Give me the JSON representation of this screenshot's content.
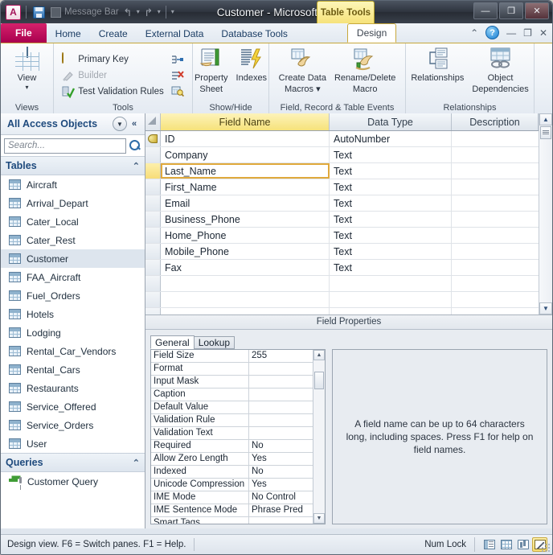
{
  "window": {
    "title": "Customer  -  Microsoft A...",
    "context_tab_banner": "Table Tools",
    "minimize": "—",
    "restore": "❐",
    "close": "✕"
  },
  "qat": {
    "logo": "A",
    "save_icon": "save-icon",
    "message_bar_label": "Message Bar",
    "undo": "↰",
    "redo": "↱",
    "customize": "▾"
  },
  "tabs": [
    {
      "label": "File",
      "kind": "file"
    },
    {
      "label": "Home",
      "kind": "normal"
    },
    {
      "label": "Create",
      "kind": "normal"
    },
    {
      "label": "External Data",
      "kind": "normal"
    },
    {
      "label": "Database Tools",
      "kind": "normal"
    },
    {
      "label": "Design",
      "kind": "contextual-active"
    }
  ],
  "tab_right": {
    "collapse_ribbon": "⌃",
    "help": "?",
    "minimize": "—",
    "restore": "❐",
    "close": "✕"
  },
  "ribbon": {
    "groups": [
      {
        "name": "Views",
        "label": "Views",
        "big_buttons": [
          {
            "label": "View",
            "sub": "▾",
            "icon": "table-view-icon"
          }
        ]
      },
      {
        "name": "Tools",
        "label": "Tools",
        "small_buttons": [
          {
            "label": "Primary Key",
            "icon": "key-icon",
            "disabled": false
          },
          {
            "label": "Builder",
            "icon": "builder-icon",
            "disabled": true
          },
          {
            "label": "Test Validation Rules",
            "icon": "validation-icon",
            "disabled": false
          }
        ],
        "icon_column": [
          {
            "icon": "insert-rows-icon"
          },
          {
            "icon": "delete-rows-icon"
          },
          {
            "icon": "modify-lookups-icon"
          }
        ]
      },
      {
        "name": "Show/Hide",
        "label": "Show/Hide",
        "big_buttons": [
          {
            "label": "Property",
            "label2": "Sheet",
            "icon": "property-sheet-icon"
          },
          {
            "label": "Indexes",
            "label2": "",
            "icon": "indexes-icon"
          }
        ]
      },
      {
        "name": "Field, Record & Table Events",
        "label": "Field, Record & Table Events",
        "big_buttons": [
          {
            "label": "Create Data",
            "label2": "Macros ▾",
            "icon": "create-data-macros-icon"
          },
          {
            "label": "Rename/Delete",
            "label2": "Macro",
            "icon": "rename-delete-macro-icon"
          }
        ]
      },
      {
        "name": "Relationships",
        "label": "Relationships",
        "big_buttons": [
          {
            "label": "Relationships",
            "label2": "",
            "icon": "relationships-icon"
          },
          {
            "label": "Object",
            "label2": "Dependencies",
            "icon": "object-dependencies-icon"
          }
        ]
      }
    ]
  },
  "navpane": {
    "title": "All Access Objects",
    "dropdown_icon": "chevron-down-icon",
    "collapse_icon": "double-chevron-left-icon",
    "search_placeholder": "Search...",
    "search_value": "",
    "search_icon": "search-icon",
    "groups": [
      {
        "header": "Tables",
        "collapse": "⌃",
        "items": [
          {
            "label": "Aircraft",
            "selected": false
          },
          {
            "label": "Arrival_Depart",
            "selected": false
          },
          {
            "label": "Cater_Local",
            "selected": false
          },
          {
            "label": "Cater_Rest",
            "selected": false
          },
          {
            "label": "Customer",
            "selected": true
          },
          {
            "label": "FAA_Aircraft",
            "selected": false
          },
          {
            "label": "Fuel_Orders",
            "selected": false
          },
          {
            "label": "Hotels",
            "selected": false
          },
          {
            "label": "Lodging",
            "selected": false
          },
          {
            "label": "Rental_Car_Vendors",
            "selected": false
          },
          {
            "label": "Rental_Cars",
            "selected": false
          },
          {
            "label": "Restaurants",
            "selected": false
          },
          {
            "label": "Service_Offered",
            "selected": false
          },
          {
            "label": "Service_Orders",
            "selected": false
          },
          {
            "label": "User",
            "selected": false
          }
        ]
      },
      {
        "header": "Queries",
        "collapse": "⌃",
        "items": [
          {
            "label": "Customer Query",
            "selected": false,
            "icon": "query-icon"
          }
        ]
      }
    ]
  },
  "design_grid": {
    "columns": [
      "Field Name",
      "Data Type",
      "Description"
    ],
    "rows": [
      {
        "field": "ID",
        "type": "AutoNumber",
        "description": "",
        "primary_key": true,
        "current": false
      },
      {
        "field": "Company",
        "type": "Text",
        "description": "",
        "primary_key": false,
        "current": false
      },
      {
        "field": "Last_Name",
        "type": "Text",
        "description": "",
        "primary_key": false,
        "current": true
      },
      {
        "field": "First_Name",
        "type": "Text",
        "description": "",
        "primary_key": false,
        "current": false
      },
      {
        "field": "Email",
        "type": "Text",
        "description": "",
        "primary_key": false,
        "current": false
      },
      {
        "field": "Business_Phone",
        "type": "Text",
        "description": "",
        "primary_key": false,
        "current": false
      },
      {
        "field": "Home_Phone",
        "type": "Text",
        "description": "",
        "primary_key": false,
        "current": false
      },
      {
        "field": "Mobile_Phone",
        "type": "Text",
        "description": "",
        "primary_key": false,
        "current": false
      },
      {
        "field": "Fax",
        "type": "Text",
        "description": "",
        "primary_key": false,
        "current": false
      }
    ],
    "scroll_up": "▲",
    "scroll_down": "▼"
  },
  "field_properties": {
    "title": "Field Properties",
    "tabs": [
      {
        "label": "General",
        "active": true
      },
      {
        "label": "Lookup",
        "active": false
      }
    ],
    "rows": [
      {
        "name": "Field Size",
        "value": "255"
      },
      {
        "name": "Format",
        "value": ""
      },
      {
        "name": "Input Mask",
        "value": ""
      },
      {
        "name": "Caption",
        "value": ""
      },
      {
        "name": "Default Value",
        "value": ""
      },
      {
        "name": "Validation Rule",
        "value": ""
      },
      {
        "name": "Validation Text",
        "value": ""
      },
      {
        "name": "Required",
        "value": "No"
      },
      {
        "name": "Allow Zero Length",
        "value": "Yes"
      },
      {
        "name": "Indexed",
        "value": "No"
      },
      {
        "name": "Unicode Compression",
        "value": "Yes"
      },
      {
        "name": "IME Mode",
        "value": "No Control"
      },
      {
        "name": "IME Sentence Mode",
        "value": "Phrase Pred"
      },
      {
        "name": "Smart Tags",
        "value": ""
      }
    ],
    "scroll_up": "▲",
    "scroll_down": "▼",
    "help_text": "A field name can be up to 64 characters long, including spaces. Press F1 for help on field names."
  },
  "statusbar": {
    "message": "Design view.  F6 = Switch panes.  F1 = Help.",
    "num_lock": "Num Lock",
    "view_buttons": [
      {
        "name": "datasheet-view-button",
        "active": false
      },
      {
        "name": "pivottable-view-button",
        "active": false
      },
      {
        "name": "pivotchart-view-button",
        "active": false
      },
      {
        "name": "design-view-button",
        "active": true
      }
    ]
  }
}
